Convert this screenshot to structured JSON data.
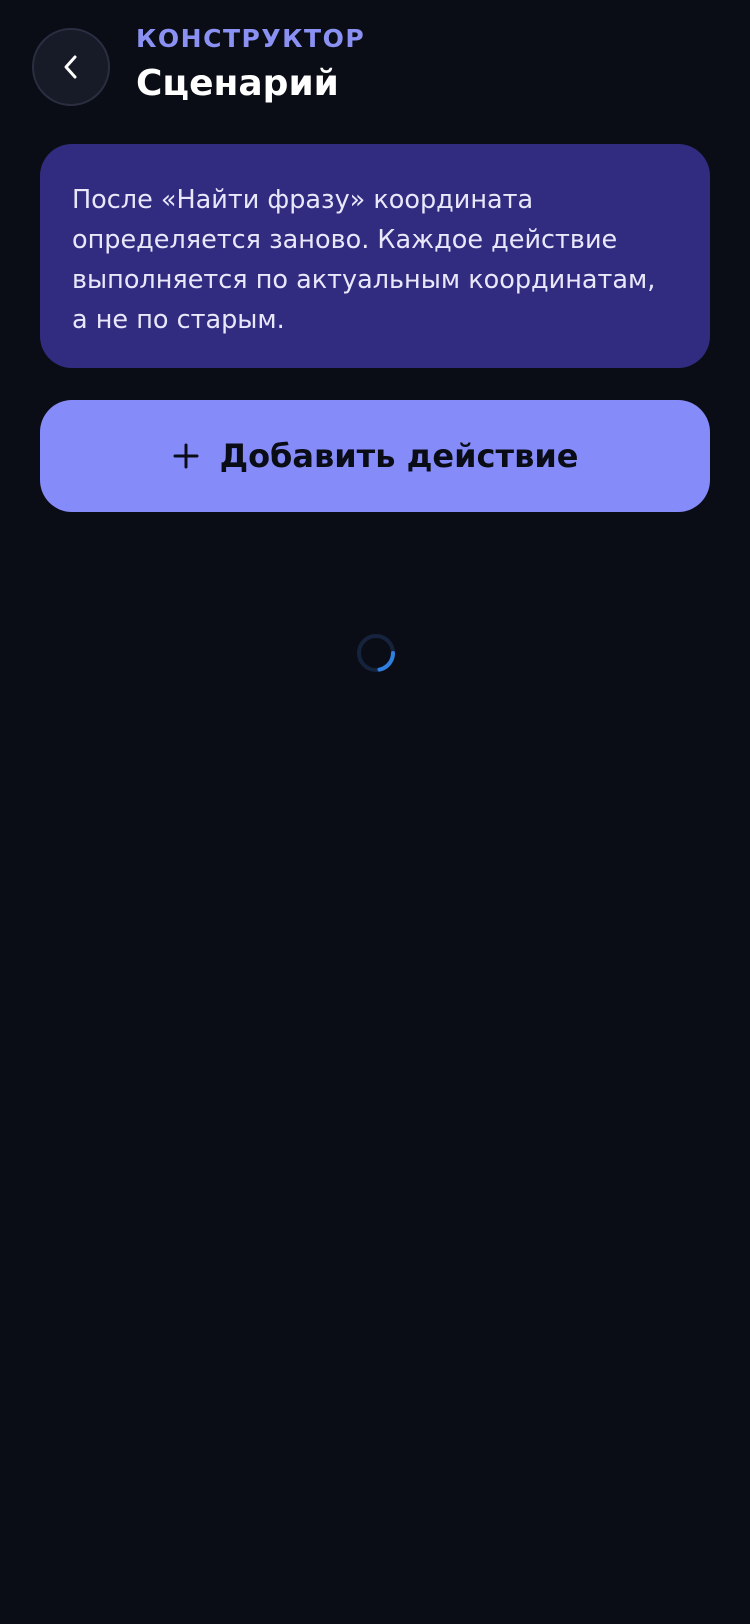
{
  "header": {
    "back_icon": "chevron-left-icon",
    "eyebrow": "КОНСТРУКТОР",
    "title": "Сценарий"
  },
  "info_card": {
    "text": "После «Найти фразу» координата определяется заново. Каждое действие выполняется по актуальным координатам, а не по старым."
  },
  "add_action": {
    "icon": "plus-icon",
    "label": "Добавить действие"
  },
  "loading": {
    "icon": "loading-spinner-icon"
  },
  "colors": {
    "background": "#0b0d16",
    "accent": "#858cfa",
    "eyebrow": "#8a91f2",
    "info_card": "#322c80",
    "spinner": "#2f7fe0"
  }
}
